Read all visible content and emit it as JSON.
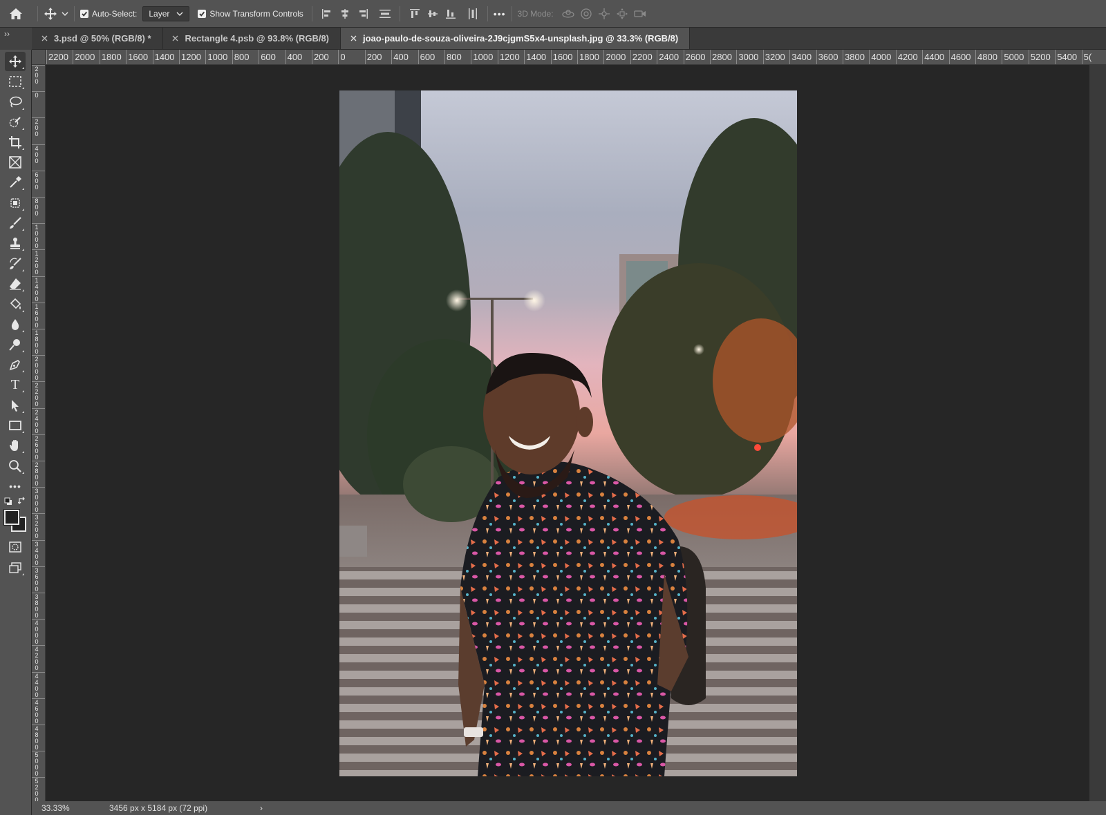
{
  "options_bar": {
    "auto_select_label": "Auto-Select:",
    "auto_select_checked": true,
    "auto_select_target": "Layer",
    "show_transform_label": "Show Transform Controls",
    "show_transform_checked": true,
    "more_label": "•••",
    "mode_3d_label": "3D Mode:"
  },
  "collapse_label": "››",
  "tabs": [
    {
      "title": "3.psd @ 50% (RGB/8) *",
      "active": false
    },
    {
      "title": "Rectangle 4.psb @ 93.8% (RGB/8)",
      "active": false
    },
    {
      "title": "joao-paulo-de-souza-oliveira-2J9cjgmS5x4-unsplash.jpg @ 33.3% (RGB/8)",
      "active": true
    }
  ],
  "toolbar": {
    "tools": [
      {
        "name": "move-tool",
        "icon": "move-icon",
        "active": true
      },
      {
        "name": "rectangular-marquee-tool",
        "icon": "marquee-icon"
      },
      {
        "name": "lasso-tool",
        "icon": "lasso-icon"
      },
      {
        "name": "quick-selection-tool",
        "icon": "quick-selection-icon"
      },
      {
        "name": "crop-tool",
        "icon": "crop-icon"
      },
      {
        "name": "frame-tool",
        "icon": "frame-icon"
      },
      {
        "name": "eyedropper-tool",
        "icon": "eyedropper-icon"
      },
      {
        "name": "spot-healing-tool",
        "icon": "healing-icon"
      },
      {
        "name": "brush-tool",
        "icon": "brush-icon"
      },
      {
        "name": "clone-stamp-tool",
        "icon": "stamp-icon"
      },
      {
        "name": "history-brush-tool",
        "icon": "history-brush-icon"
      },
      {
        "name": "eraser-tool",
        "icon": "eraser-icon"
      },
      {
        "name": "paint-bucket-tool",
        "icon": "paint-bucket-icon"
      },
      {
        "name": "blur-tool",
        "icon": "blur-icon"
      },
      {
        "name": "dodge-tool",
        "icon": "dodge-icon"
      },
      {
        "name": "pen-tool",
        "icon": "pen-icon"
      },
      {
        "name": "type-tool",
        "icon": "type-icon"
      },
      {
        "name": "path-selection-tool",
        "icon": "path-selection-icon"
      },
      {
        "name": "rectangle-tool",
        "icon": "rectangle-icon"
      },
      {
        "name": "hand-tool",
        "icon": "hand-icon"
      },
      {
        "name": "zoom-tool",
        "icon": "zoom-icon"
      },
      {
        "name": "edit-toolbar",
        "icon": "more-icon"
      }
    ],
    "type_glyph": "T",
    "more_glyph": "•••"
  },
  "ruler_top": [
    "2200",
    "2000",
    "1800",
    "1600",
    "1400",
    "1200",
    "1000",
    "800",
    "600",
    "400",
    "200",
    "0",
    "200",
    "400",
    "600",
    "800",
    "1000",
    "1200",
    "1400",
    "1600",
    "1800",
    "2000",
    "2200",
    "2400",
    "2600",
    "2800",
    "3000",
    "3200",
    "3400",
    "3600",
    "3800",
    "4000",
    "4200",
    "4400",
    "4600",
    "4800",
    "5000",
    "5200",
    "5400",
    "5("
  ],
  "ruler_left": [
    "200",
    "0",
    "200",
    "400",
    "600",
    "800",
    "1000",
    "1200",
    "1400",
    "1600",
    "1800",
    "2000",
    "2200",
    "2400",
    "2600",
    "2800",
    "3000",
    "3200",
    "3400",
    "3600",
    "3800",
    "4000",
    "4200",
    "4400",
    "4600",
    "4800",
    "5000",
    "5200"
  ],
  "status": {
    "zoom": "33.33%",
    "doc_info": "3456 px x 5184 px (72 ppi)",
    "arrow": "›"
  },
  "colors": {
    "panel": "#535353",
    "canvas_bg": "#262626",
    "tab_bar": "#3a3a3a",
    "active_tab": "#535353"
  }
}
